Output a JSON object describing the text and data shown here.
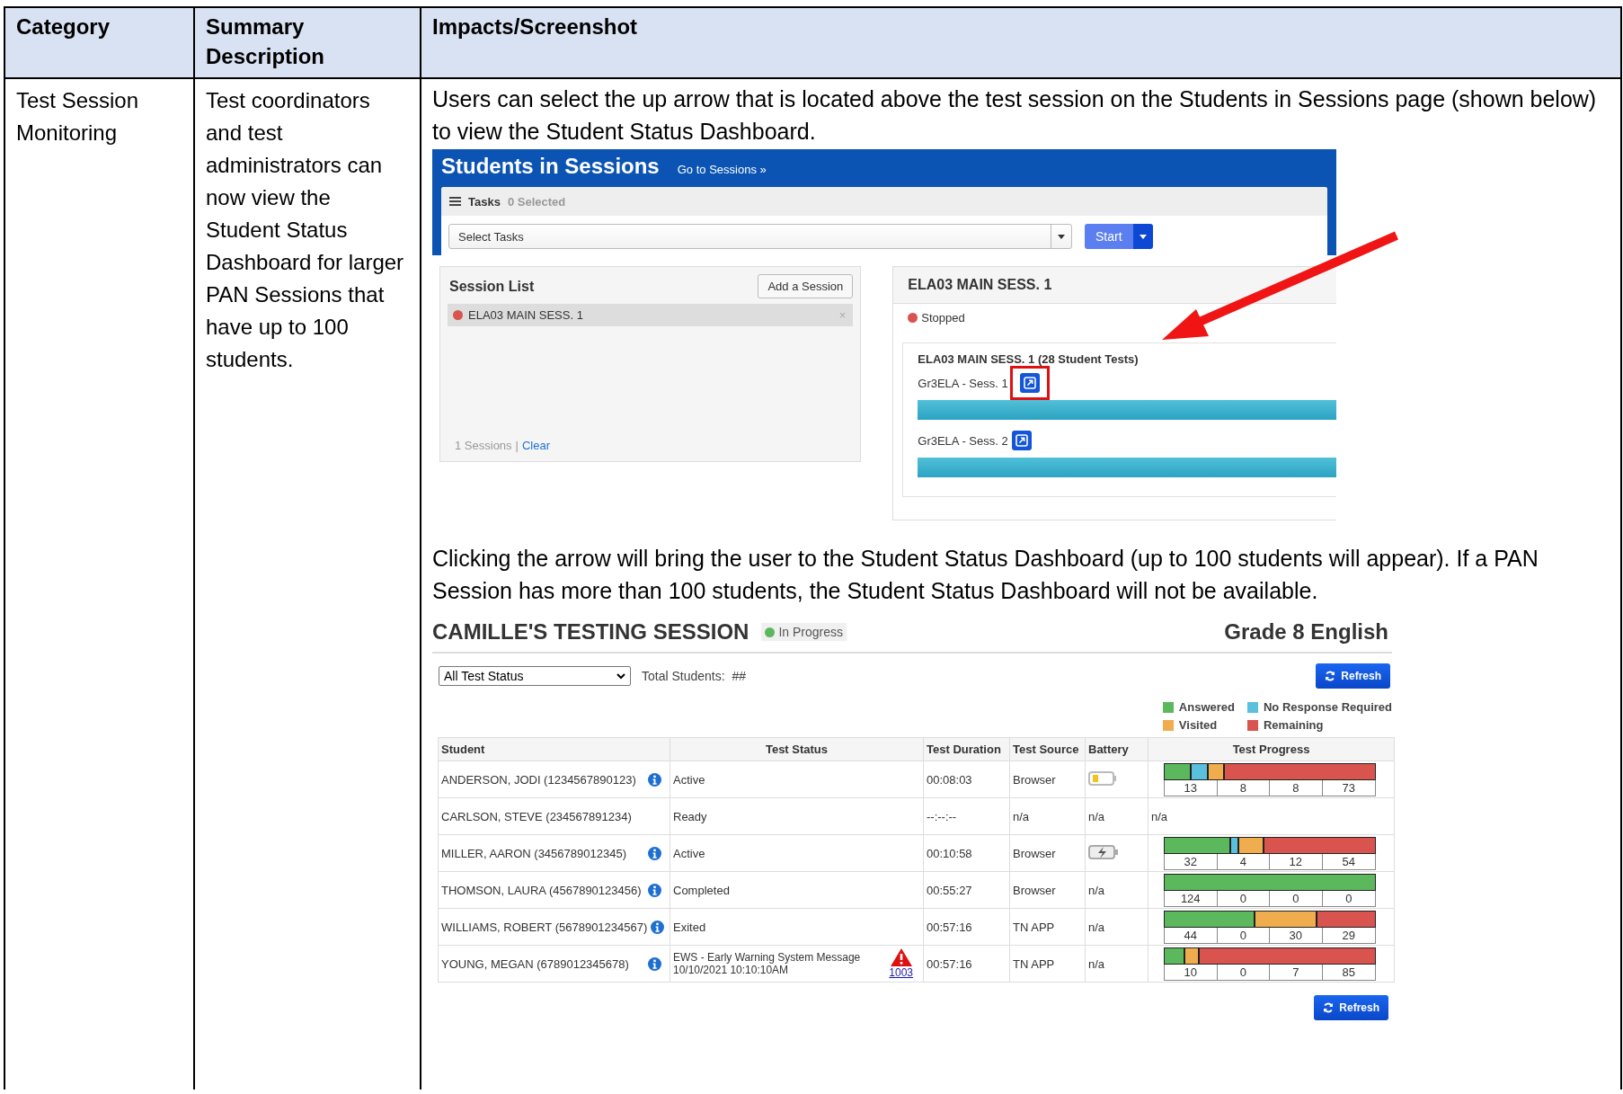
{
  "table": {
    "columns": [
      "Category",
      "Summary Description",
      "Impacts/Screenshot"
    ],
    "rows": [
      {
        "category": "Test Session Monitoring",
        "summary": "Test coordinators and test administrators can now view the Student Status Dashboard for larger PAN Sessions that have up to 100 students.",
        "intro": "Users can select the up arrow that is located above the test session on the Students in Sessions page (shown below) to view the Student Status Dashboard.",
        "students_in_sessions": {
          "title": "Students in Sessions",
          "link": "Go to Sessions »",
          "tasks_label": "Tasks",
          "selected_count": "0 Selected",
          "task_select": "Select Tasks",
          "start_button": "Start",
          "session_list": {
            "title": "Session List",
            "add_button": "Add a Session",
            "items": [
              {
                "name": "ELA03 MAIN SESS. 1",
                "selected": true,
                "close": "×"
              }
            ],
            "count": "1 Sessions",
            "separator": "|",
            "clear": "Clear"
          },
          "session_detail": {
            "title": "ELA03 MAIN SESS. 1",
            "status": "Stopped",
            "group_title": "ELA03 MAIN SESS. 1 (28 Student Tests)",
            "tests": [
              {
                "name": "Gr3ELA - Sess. 1",
                "highlighted": true,
                "level": 1
              },
              {
                "name": "Gr3ELA - Sess. 2",
                "highlighted": false,
                "level": 1
              }
            ]
          }
        },
        "followup": "Clicking the arrow will bring the user to the Student Status Dashboard (up to 100 students will appear).  If a PAN Session has more than 100 students, the Student Status Dashboard will not be available.",
        "dashboard": {
          "title": "CAMILLE'S TESTING SESSION",
          "status": "In Progress",
          "subject": "Grade 8 English",
          "filter": "All Test Status",
          "total_label": "Total Students:",
          "total_value": "##",
          "refresh_top": "Refresh",
          "legend": [
            {
              "label": "Answered",
              "color": "#5cb85c"
            },
            {
              "label": "No Response Required",
              "color": "#5bc0de"
            },
            {
              "label": "Visited",
              "color": "#f0ad4e"
            },
            {
              "label": "Remaining",
              "color": "#d9534f"
            }
          ],
          "columns": [
            "Student",
            "Test Status",
            "Test Duration",
            "Test Source",
            "Battery",
            "Test Progress"
          ],
          "rows": [
            {
              "student": "ANDERSON, JODI (1234567890123)",
              "info_icon": true,
              "status": "Active",
              "duration": "00:08:03",
              "source": "Browser",
              "battery": {
                "kind": "low"
              },
              "progress": {
                "kind": "bar",
                "counts": [
                  "13",
                  "8",
                  "8",
                  "73"
                ]
              }
            },
            {
              "student": "CARLSON, STEVE (234567891234)",
              "info_icon": false,
              "status": "Ready",
              "duration": "--:--:--",
              "source": "n/a",
              "battery": {
                "kind": "text",
                "text": "n/a"
              },
              "progress": {
                "kind": "text",
                "text": "n/a"
              }
            },
            {
              "student": "MILLER, AARON (3456789012345)",
              "info_icon": true,
              "status": "Active",
              "duration": "00:10:58",
              "source": "Browser",
              "battery": {
                "kind": "charging"
              },
              "progress": {
                "kind": "bar",
                "counts": [
                  "32",
                  "4",
                  "12",
                  "54"
                ]
              }
            },
            {
              "student": "THOMSON, LAURA (4567890123456)",
              "info_icon": true,
              "status": "Completed",
              "duration": "00:55:27",
              "source": "Browser",
              "battery": {
                "kind": "text",
                "text": "n/a"
              },
              "progress": {
                "kind": "bar",
                "counts": [
                  "124",
                  "0",
                  "0",
                  "0"
                ]
              }
            },
            {
              "student": "WILLIAMS, ROBERT (5678901234567)",
              "info_icon": true,
              "status": "Exited",
              "duration": "00:57:16",
              "source": "TN APP",
              "battery": {
                "kind": "text",
                "text": "n/a"
              },
              "progress": {
                "kind": "bar",
                "counts": [
                  "44",
                  "0",
                  "30",
                  "29"
                ]
              }
            },
            {
              "student": "YOUNG, MEGAN (6789012345678)",
              "info_icon": true,
              "status": "EWS - Early Warning System Message",
              "status_time": "10/10/2021 10:10:10AM",
              "alert_link": "1003",
              "duration": "00:57:16",
              "source": "TN APP",
              "battery": {
                "kind": "text",
                "text": "n/a"
              },
              "progress": {
                "kind": "bar",
                "counts": [
                  "10",
                  "0",
                  "7",
                  "85"
                ]
              }
            }
          ],
          "refresh_bottom": "Refresh"
        }
      }
    ]
  }
}
